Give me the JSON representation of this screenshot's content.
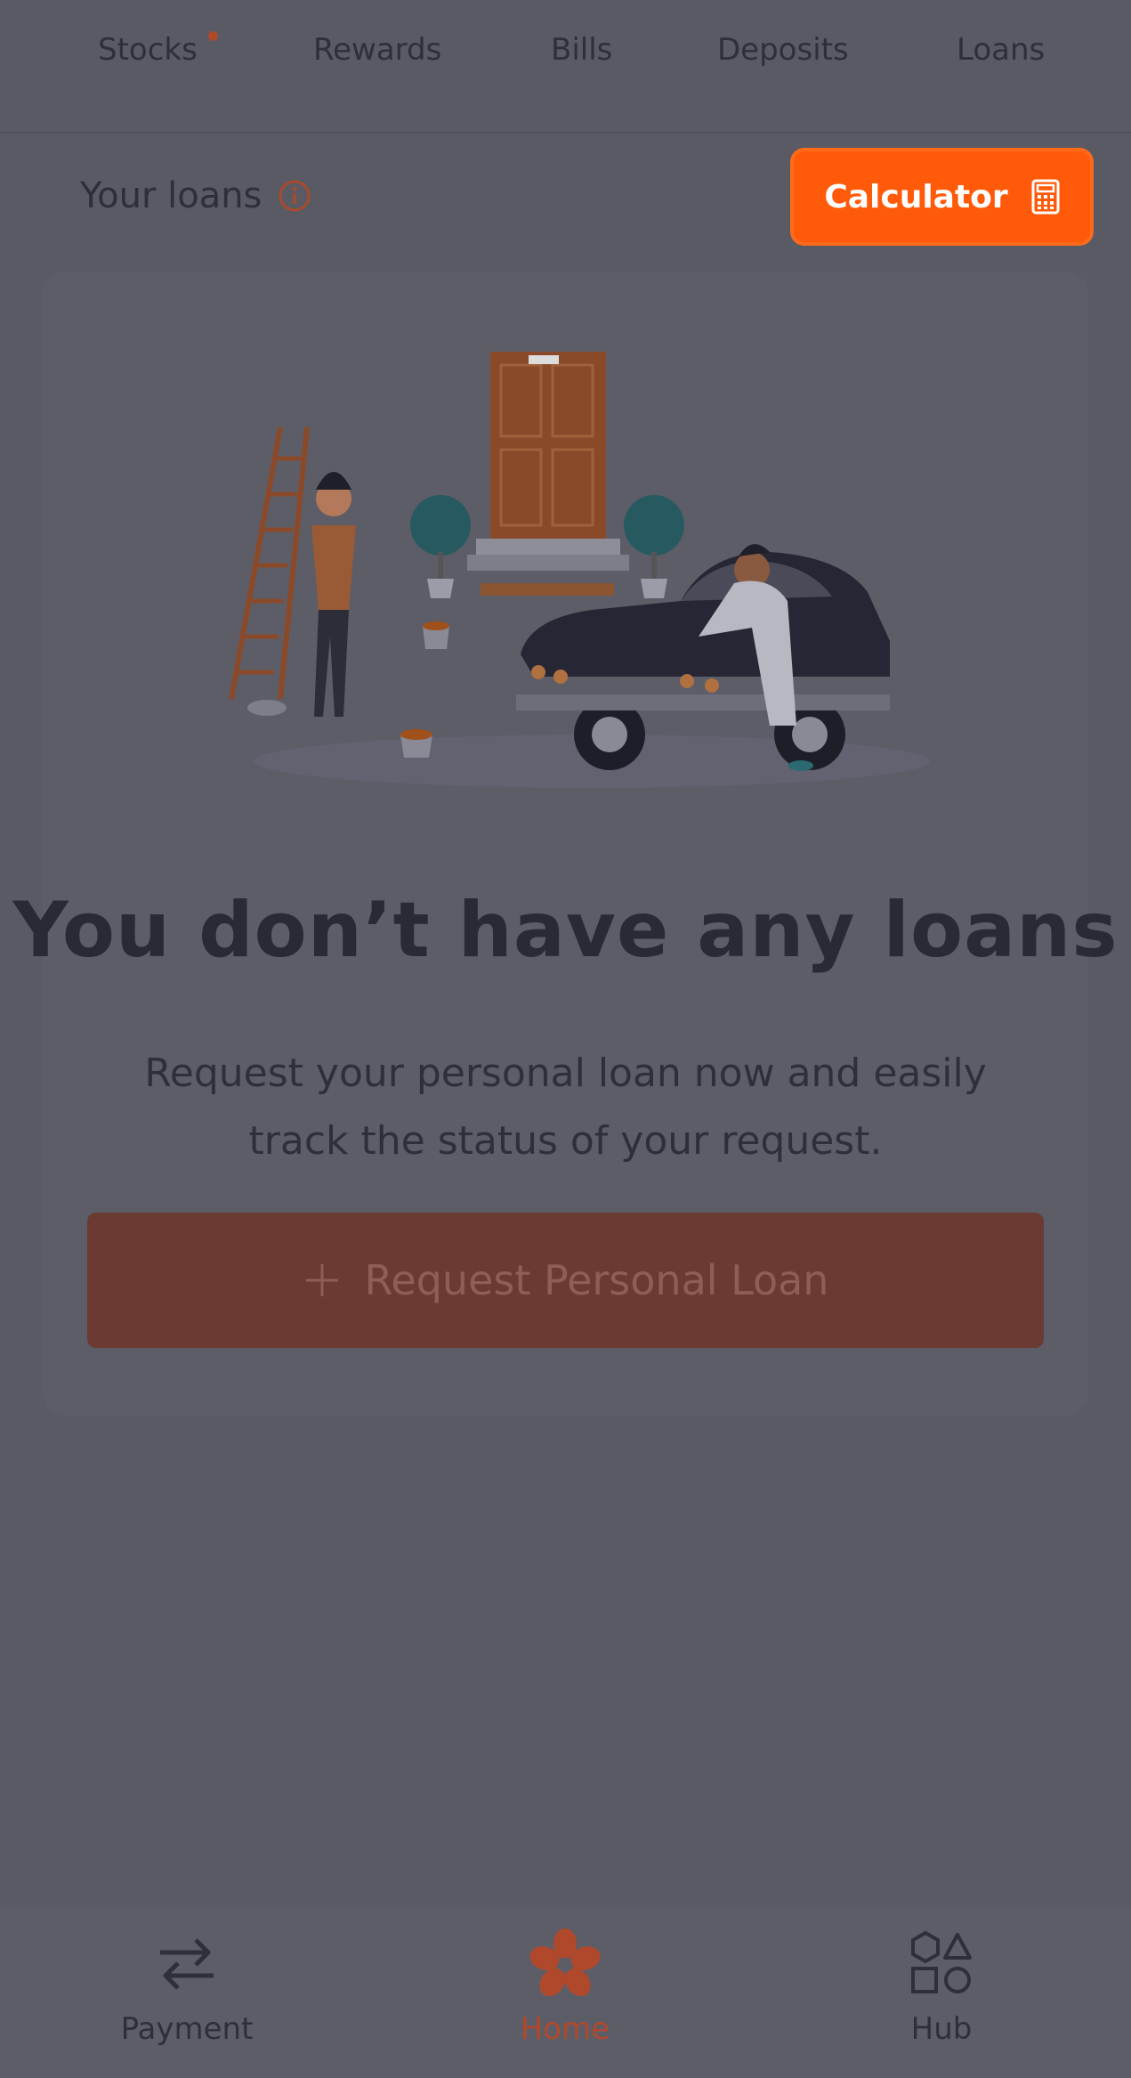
{
  "tabs": [
    {
      "label": "Stocks",
      "has_dot": true
    },
    {
      "label": "Rewards"
    },
    {
      "label": "Bills"
    },
    {
      "label": "Deposits"
    },
    {
      "label": "Loans"
    }
  ],
  "header": {
    "title": "Your loans",
    "calculator_label": "Calculator"
  },
  "empty_state": {
    "headline": "You don’t have any loans",
    "subtext_line1": "Request your personal loan now and easily",
    "subtext_line2": "track the status of your request.",
    "button_label": "Request Personal Loan"
  },
  "bottom_nav": [
    {
      "label": "Payment",
      "icon": "transfer-arrows-icon"
    },
    {
      "label": "Home",
      "icon": "flower-logo-icon",
      "active": true
    },
    {
      "label": "Hub",
      "icon": "shapes-icon"
    }
  ],
  "colors": {
    "overlay_background": "#5a5a65",
    "accent": "#ff5a0a",
    "active_nav": "#b0492c",
    "dimmed_button": "#6a3a33"
  }
}
